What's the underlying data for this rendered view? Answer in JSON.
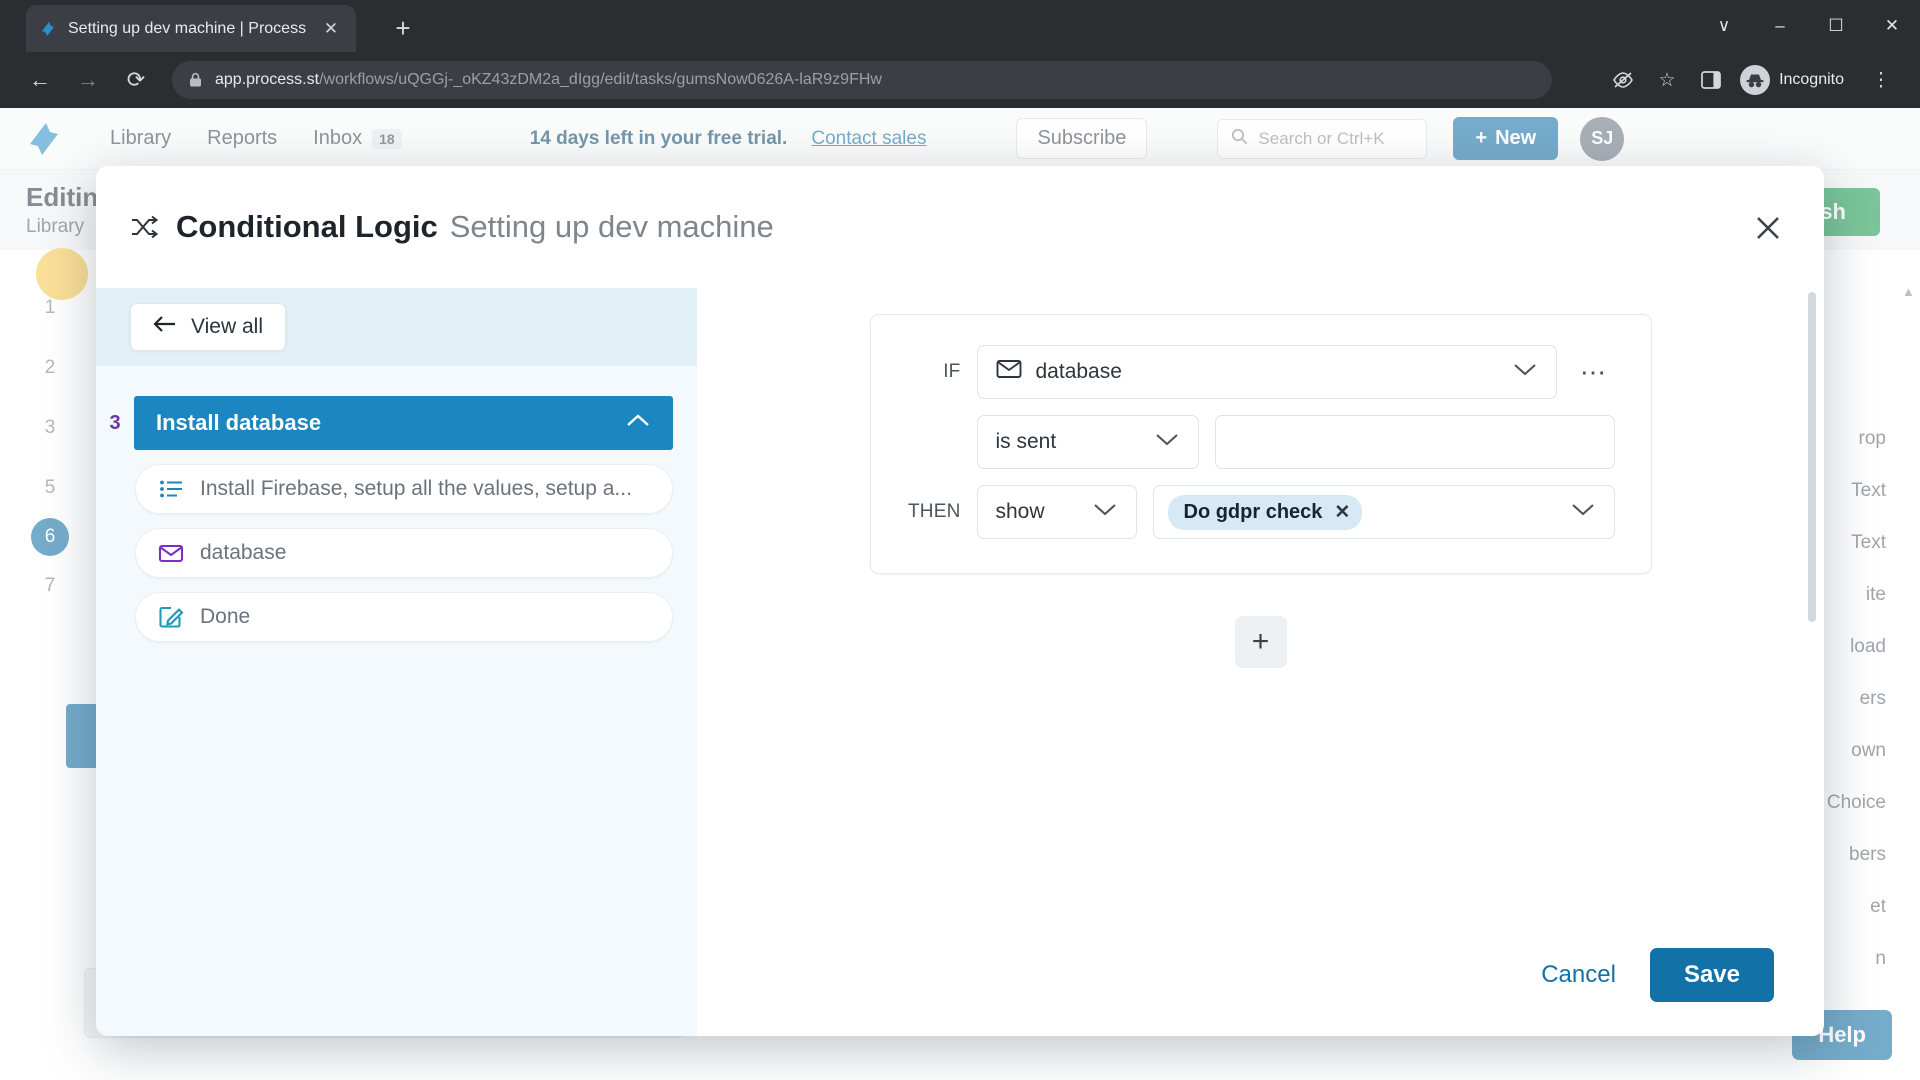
{
  "browser": {
    "tab": {
      "title": "Setting up dev machine | Process",
      "favicon_icon": "process-st-logo-icon",
      "close_icon": "close-icon"
    },
    "new_tab_icon": "plus-icon",
    "window_controls": [
      {
        "name": "minimize-to-tray",
        "icon": "chevron-down-icon",
        "glyph": "∨"
      },
      {
        "name": "minimize",
        "icon": "minimize-icon",
        "glyph": "–"
      },
      {
        "name": "maximize",
        "icon": "maximize-icon",
        "glyph": "☐"
      },
      {
        "name": "close",
        "icon": "close-icon",
        "glyph": "✕"
      }
    ],
    "toolbar": {
      "back_icon": "arrow-left-icon",
      "forward_icon": "arrow-right-icon",
      "reload_icon": "reload-icon",
      "lock_icon": "lock-icon",
      "url_domain": "app.process.st",
      "url_path": "/workflows/uQGGj-_oKZ43zDM2a_dIgg/edit/tasks/gumsNow0626A-laR9z9FHw",
      "tracking_icon": "eye-slash-icon",
      "bookmark_icon": "star-icon",
      "sidepanel_icon": "side-panel-icon",
      "profile_label": "Incognito",
      "profile_icon": "incognito-hat-icon",
      "menu_icon": "kebab-menu-icon"
    }
  },
  "app": {
    "logo_icon": "process-st-logo-icon",
    "nav_links": [
      {
        "label": "Library",
        "badge": null
      },
      {
        "label": "Reports",
        "badge": null
      },
      {
        "label": "Inbox",
        "badge": "18"
      }
    ],
    "trial_text": "14 days left in your free trial.",
    "trial_link": "Contact sales",
    "subscribe_label": "Subscribe",
    "search_placeholder": "Search or Ctrl+K",
    "search_icon": "search-icon",
    "new_button_label": "New",
    "new_button_icon": "plus-icon",
    "avatar_initials": "SJ",
    "editor_title": "Editing",
    "editor_subtitle": "Library",
    "publish_label": "ish",
    "left_rail_numbers": [
      "1",
      "2",
      "3",
      "5",
      "6",
      "7"
    ],
    "left_rail_active": "6",
    "right_rail_items": [
      "rop",
      "Text",
      "Text",
      "ite",
      "load",
      "ers",
      "own",
      "Choice",
      "bers",
      "et",
      "n"
    ],
    "help_label": "Help"
  },
  "modal": {
    "icon": "shuffle-icon",
    "title": "Conditional Logic",
    "subtitle": "Setting up dev machine",
    "close_icon": "close-icon",
    "left_panel": {
      "view_all_label": "View all",
      "view_all_icon": "arrow-left-icon",
      "task": {
        "index": "3",
        "name": "Install database",
        "collapse_icon": "chevron-up-icon"
      },
      "fields": [
        {
          "label": "Install Firebase, setup all the values, setup a...",
          "icon": "list-icon",
          "icon_color": "#1b86bf"
        },
        {
          "label": "database",
          "icon": "email-icon",
          "icon_color": "#7b2ec8"
        },
        {
          "label": "Done",
          "icon": "edit-square-icon",
          "icon_color": "#1b9bb5"
        }
      ]
    },
    "rule": {
      "if_keyword": "IF",
      "if_value": "database",
      "if_value_icon": "email-icon",
      "if_dropdown_icon": "chevron-down-icon",
      "more_options_icon": "ellipsis-icon",
      "condition_value": "is sent",
      "condition_dropdown_icon": "chevron-down-icon",
      "condition_input_value": "",
      "then_keyword": "THEN",
      "then_action": "show",
      "then_action_icon": "chevron-down-icon",
      "then_targets": [
        {
          "label": "Do gdpr check",
          "remove_icon": "close-icon"
        }
      ],
      "then_dropdown_icon": "chevron-down-icon",
      "add_rule_icon": "plus-icon"
    },
    "footer": {
      "cancel_label": "Cancel",
      "save_label": "Save"
    }
  }
}
